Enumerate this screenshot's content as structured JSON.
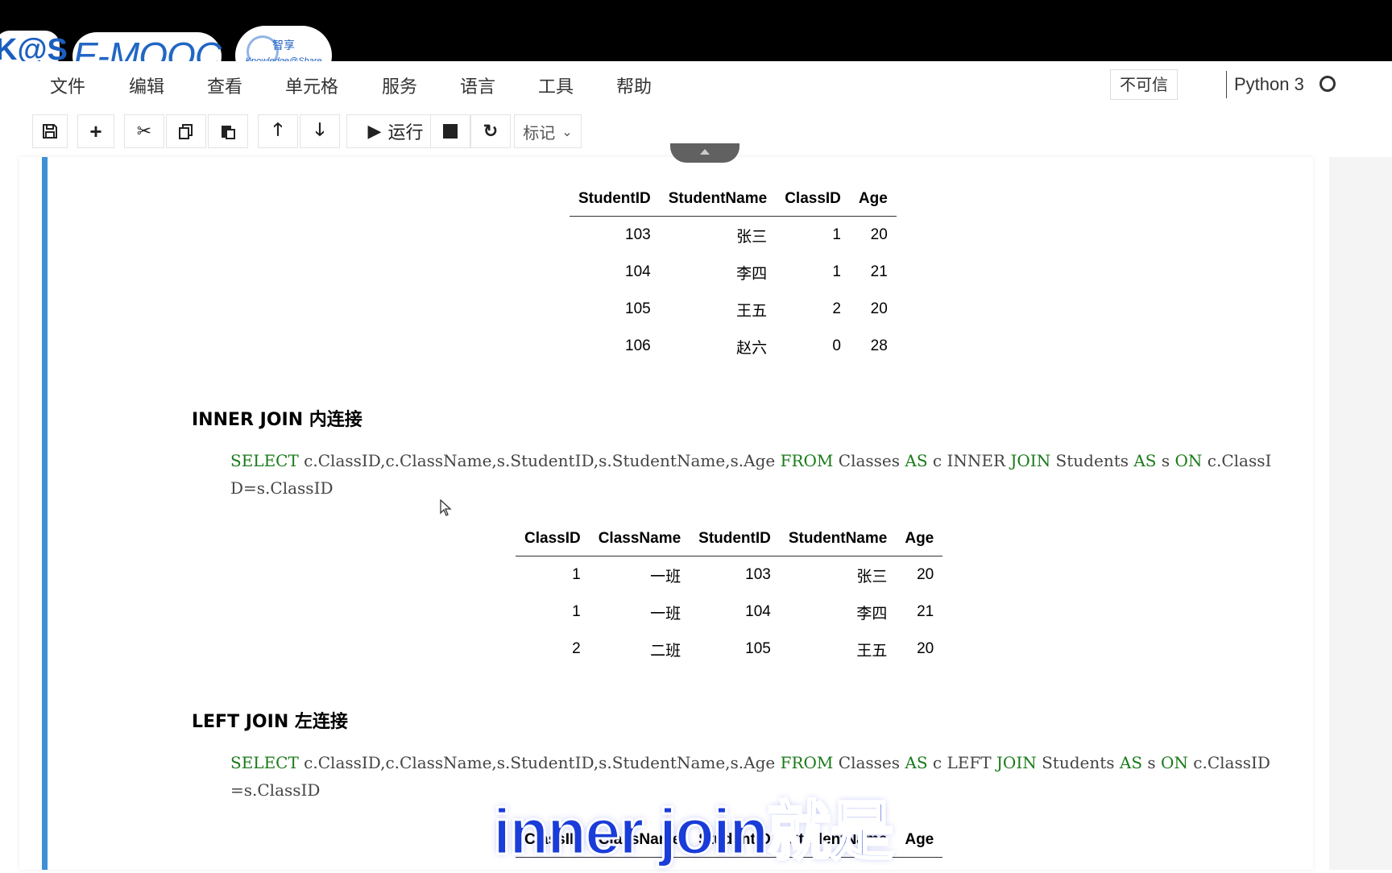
{
  "overlay": {
    "logo_kas": "K@S",
    "logo_emooc": "E-MOOC",
    "logo_knowledge_zh": "智享",
    "logo_knowledge_en": "Knowledge@Share",
    "subtitle": "inner join就是"
  },
  "menu": {
    "items": [
      "文件",
      "编辑",
      "查看",
      "单元格",
      "服务",
      "语言",
      "工具",
      "帮助"
    ],
    "trust": "不可信",
    "kernel": "Python 3"
  },
  "toolbar": {
    "run_label": "运行",
    "cell_type": "标记"
  },
  "table_students": {
    "headers": [
      "StudentID",
      "StudentName",
      "ClassID",
      "Age"
    ],
    "rows": [
      [
        "103",
        "张三",
        "1",
        "20"
      ],
      [
        "104",
        "李四",
        "1",
        "21"
      ],
      [
        "105",
        "王五",
        "2",
        "20"
      ],
      [
        "106",
        "赵六",
        "0",
        "28"
      ]
    ]
  },
  "inner_join": {
    "heading": "INNER JOIN 内连接",
    "code": [
      {
        "t": "SELECT",
        "kw": true
      },
      {
        "t": " c.ClassID,c.ClassName,s.StudentID,s.StudentName,s.Age ",
        "kw": false
      },
      {
        "t": "FROM",
        "kw": true
      },
      {
        "t": " Classes ",
        "kw": false
      },
      {
        "t": "AS",
        "kw": true
      },
      {
        "t": " c INNER ",
        "kw": false
      },
      {
        "t": "JOIN",
        "kw": true
      },
      {
        "t": " Students ",
        "kw": false
      },
      {
        "t": "AS",
        "kw": true
      },
      {
        "t": " s ",
        "kw": false
      },
      {
        "t": "ON",
        "kw": true
      },
      {
        "t": " c.ClassID=s.ClassID",
        "kw": false
      }
    ],
    "table": {
      "headers": [
        "ClassID",
        "ClassName",
        "StudentID",
        "StudentName",
        "Age"
      ],
      "rows": [
        [
          "1",
          "一班",
          "103",
          "张三",
          "20"
        ],
        [
          "1",
          "一班",
          "104",
          "李四",
          "21"
        ],
        [
          "2",
          "二班",
          "105",
          "王五",
          "20"
        ]
      ]
    }
  },
  "left_join": {
    "heading": "LEFT JOIN 左连接",
    "code": [
      {
        "t": "SELECT",
        "kw": true
      },
      {
        "t": " c.ClassID,c.ClassName,s.StudentID,s.StudentName,s.Age ",
        "kw": false
      },
      {
        "t": "FROM",
        "kw": true
      },
      {
        "t": " Classes ",
        "kw": false
      },
      {
        "t": "AS",
        "kw": true
      },
      {
        "t": " c LEFT ",
        "kw": false
      },
      {
        "t": "JOIN",
        "kw": true
      },
      {
        "t": " Students ",
        "kw": false
      },
      {
        "t": "AS",
        "kw": true
      },
      {
        "t": " s ",
        "kw": false
      },
      {
        "t": "ON",
        "kw": true
      },
      {
        "t": " c.ClassID=s.ClassID",
        "kw": false
      }
    ],
    "table_headers": [
      "ClassID",
      "ClassName",
      "StudentID",
      "StudentName",
      "Age"
    ]
  }
}
